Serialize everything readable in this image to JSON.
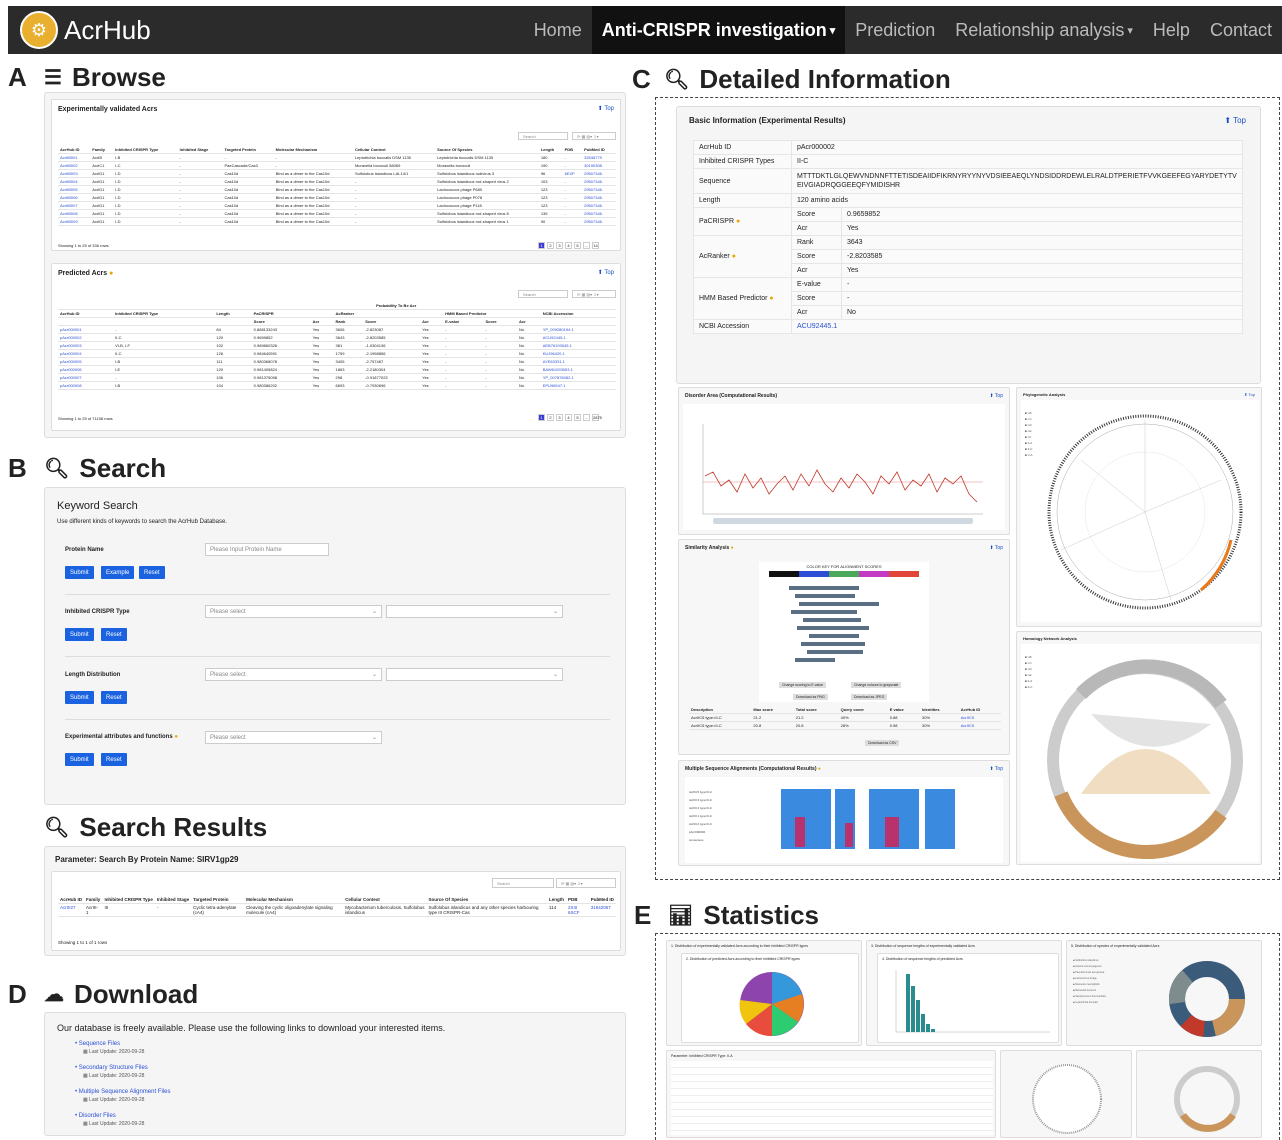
{
  "nav": {
    "brand": "AcrHub",
    "items": [
      "Home",
      "Anti-CRISPR investigation",
      "Prediction",
      "Relationship analysis",
      "Help",
      "Contact"
    ]
  },
  "sections": {
    "a_letter": "A",
    "a_title": "Browse",
    "b_letter": "B",
    "b_title": "Search",
    "sr_title": "Search Results",
    "c_letter": "C",
    "c_title": "Detailed Information",
    "d_letter": "D",
    "d_title": "Download",
    "e_letter": "E",
    "e_title": "Statistics"
  },
  "browse": {
    "top": "Top",
    "exp_title": "Experimentally validated Acrs",
    "exp_headers": [
      "AcrHub ID",
      "Family",
      "Inhibited CRISPR Type",
      "Inhibited Stage",
      "Targeted Protein",
      "Molecular Mechanism",
      "Cellular Context",
      "Source Of Species",
      "Length",
      "PDB",
      "PubMed ID"
    ],
    "exp_rows": [
      [
        "AcrIIB001",
        "AcrIB",
        "I-B",
        "-",
        "-",
        "-",
        "Leptotrichia buccalis DSM 1135",
        "Leptotrichia buccalis DSM 1135",
        "180",
        "-",
        "32548779"
      ],
      [
        "AcrIIB002",
        "AcrIC1",
        "I-C",
        "-",
        "PaeCascade/Cas3",
        "-",
        "Moraxella bovoculi 58069",
        "Moraxella bovoculi",
        "190",
        "-",
        "30190308"
      ],
      [
        "AcrIIB003",
        "AcrID1",
        "I-D",
        "-",
        "Cas10d",
        "Bind as a dimer to the Cas10d",
        "Sulfolobus islandicus LAL14/1",
        "Sulfolobus islandicus rudivirus 3",
        "96",
        "6EXP",
        "29507346"
      ],
      [
        "AcrIIB004",
        "AcrID1",
        "I-D",
        "-",
        "Cas10d",
        "Bind as a dimer to the Cas10d",
        "-",
        "Sulfolobus islandicus rod-shaped virus 2",
        "103",
        "-",
        "29507346"
      ],
      [
        "AcrIIB005",
        "AcrID1",
        "I-D",
        "-",
        "Cas10d",
        "Bind as a dimer to the Cas10d",
        "-",
        "Lactococcus phage P680",
        "123",
        "-",
        "29507346"
      ],
      [
        "AcrIIB006",
        "AcrID1",
        "I-D",
        "-",
        "Cas10d",
        "Bind as a dimer to the Cas10d",
        "-",
        "Lactococcus phage P078",
        "123",
        "-",
        "29507346"
      ],
      [
        "AcrIIB007",
        "AcrID1",
        "I-D",
        "-",
        "Cas10d",
        "Bind as a dimer to the Cas10d",
        "-",
        "Lactococcus phage P118",
        "123",
        "-",
        "29507346"
      ],
      [
        "AcrIIB008",
        "AcrID1",
        "I-D",
        "-",
        "Cas10d",
        "Bind as a dimer to the Cas10d",
        "-",
        "Sulfolobus islandicus rod-shaped virus 8",
        "139",
        "-",
        "29507346"
      ],
      [
        "AcrIIB009",
        "AcrID1",
        "I-D",
        "-",
        "Cas10d",
        "Bind as a dimer to the Cas10d",
        "-",
        "Sulfolobus islandicus rod-shaped virus 1",
        "90",
        "-",
        "29507346"
      ]
    ],
    "exp_footer": "Showing 1 to 25 of 336 rows",
    "pred_title": "Predicted Acrs",
    "pred_super": "Probability To Be Acr",
    "pred_headers": [
      "AcrHub ID",
      "Inhibited CRISPR Type",
      "Length",
      "PaCRISPR",
      "AcRanker",
      "HMM Based Predictor",
      "NCBI Accession"
    ],
    "pred_sub": [
      "Score",
      "Acr",
      "Rank",
      "Score",
      "Acr",
      "E-value",
      "Score",
      "Acr"
    ],
    "pred_rows": [
      [
        "pAcr000001",
        "-",
        "84",
        "0.888133243",
        "Yes",
        "3606",
        "-2.823087",
        "Yes",
        "-",
        "-",
        "No",
        "YP_009280194.1"
      ],
      [
        "pAcr000002",
        "II-C",
        "120",
        "0.9659852",
        "Yes",
        "3643",
        "-2.8203585",
        "Yes",
        "-",
        "-",
        "No",
        "ACU92445.1"
      ],
      [
        "pAcr000003",
        "VI-B, I-F",
        "102",
        "0.989860326",
        "Yes",
        "381",
        "-1.0304136",
        "Yes",
        "-",
        "-",
        "No",
        "AEB76193045.1"
      ],
      [
        "pAcr000004",
        "II-C",
        "126",
        "0.984640591",
        "Yes",
        "1759",
        "-2.1998856",
        "Yes",
        "-",
        "-",
        "No",
        "KUJ96420.1"
      ],
      [
        "pAcr000005",
        "I-B",
        "111",
        "0.980368078",
        "Yes",
        "3405",
        "-2.757487",
        "Yes",
        "-",
        "-",
        "No",
        "AYE63331.1"
      ],
      [
        "pAcr000006",
        "I-E",
        "120",
        "0.981405824",
        "Yes",
        "1863",
        "-2.2180304",
        "Yes",
        "-",
        "-",
        "No",
        "BAW61093053.1"
      ],
      [
        "pAcr000007",
        "-",
        "106",
        "0.981375098",
        "Yes",
        "298",
        "-0.91877023",
        "Yes",
        "-",
        "-",
        "No",
        "YP_007878082.1"
      ],
      [
        "pAcr000008",
        "I-B",
        "104",
        "0.980386202",
        "Yes",
        "6693",
        "-0.7930696",
        "Yes",
        "-",
        "-",
        "No",
        "EPU96547.1"
      ]
    ],
    "pred_footer": "Showing 1 to 25 of 71158 rows",
    "search_ph": "Search"
  },
  "search": {
    "title": "Keyword Search",
    "subtitle": "Use different kinds of keywords to search the AcrHub Database.",
    "protein_label": "Protein Name",
    "protein_ph": "Please Input Protein Name",
    "type_label": "Inhibited CRISPR Type",
    "length_label": "Length Distribution",
    "attr_label": "Experimental attributes and functions",
    "select_ph": "Please select",
    "submit": "Submit",
    "example": "Example",
    "reset": "Reset"
  },
  "results": {
    "param": "Parameter: Search By Protein Name: SIRV1gp29",
    "headers": [
      "AcrHub ID",
      "Family",
      "Inhibited CRISPR Type",
      "Inhibited Stage",
      "Targeted Protein",
      "Molecular Mechanism",
      "Cellular Context",
      "Source Of Species",
      "Length",
      "PDB",
      "PubMed ID"
    ],
    "row": [
      "AcrIII27",
      "AcrIII-1",
      "III",
      "-",
      "Cyclic tetra-adenylate (cA4)",
      "Cleaving the cyclic oligoadenylate signaling molecule (cA4)",
      "Mycobacterium tuberculosis, Sulfolobus islandicus",
      "Sulfolobus islandicus and any other species harbouring type III CRISPR-Cas",
      "114",
      "2X4I 6SCF",
      "31942067"
    ],
    "footer": "Showing 1 to 1 of 1 rows"
  },
  "download": {
    "intro": "Our database is freely available. Please use the following links to download your interested items.",
    "files": [
      {
        "name": "Sequence Files",
        "date": "Last Update: 2020-09-28"
      },
      {
        "name": "Secondary Structure Files",
        "date": "Last Update: 2020-09-28"
      },
      {
        "name": "Multiple Sequence Alignment Files",
        "date": "Last Update: 2020-09-28"
      },
      {
        "name": "Disorder Files",
        "date": "Last Update: 2020-09-28"
      }
    ]
  },
  "detail": {
    "title": "Basic Information (Experimental Results)",
    "top": "Top",
    "acrhub_id_label": "AcrHub ID",
    "acrhub_id": "pAcr000002",
    "type_label": "Inhibited CRISPR Types",
    "type": "II-C",
    "seq_label": "Sequence",
    "seq": "MTTTDKTLGLQEWVNDNNFTTETISDEAIIDFIKRNYRYYNYVDSIEEAEQLYNDSIDDRDEWLELRALDTPERIETFVVKGEEFEGYARYDETYTVEIVGIADRQGGEEQFYMIDISHR",
    "length_label": "Length",
    "length": "120 amino acids",
    "pacrispr_label": "PaCRISPR",
    "acranker_label": "AcRanker",
    "hmm_label": "HMM Based Predictor",
    "score_label": "Score",
    "acr_label": "Acr",
    "rank_label": "Rank",
    "evalue_label": "E-value",
    "pacrispr_score": "0.9659852",
    "pacrispr_acr": "Yes",
    "acranker_rank": "3643",
    "acranker_score": "-2.8203585",
    "acranker_acr": "Yes",
    "hmm_evalue": "-",
    "hmm_score": "-",
    "hmm_acr": "No",
    "ncbi_label": "NCBI Accession",
    "ncbi": "ACU92445.1",
    "disorder_title": "Disorder Area (Computational Results)",
    "phylo_title": "Phylogenetic Analysis",
    "similarity_title": "Similarity Analysis",
    "color_key": "COLOR KEY FOR ALIGNMENT SCORES",
    "homology_title": "Homology Network Analysis",
    "msa_title": "Multiple Sequence Alignments (Computational Results)",
    "sim_headers": [
      "Description",
      "Max score",
      "Total score",
      "Query cover",
      "E value",
      "Identities",
      "AcrHub ID"
    ],
    "sim_rows": [
      [
        "AcrIIC5 type=II-C",
        "21.2",
        "21.2",
        "40%",
        "0.88",
        "30%",
        "AcrIIC5"
      ],
      [
        "AcrIIC5 type=II-C",
        "20.8",
        "20.8",
        "28%",
        "0.98",
        "30%",
        "AcrIIC5"
      ]
    ],
    "btns": [
      "Change scoring to E value",
      "Change colours to grayscale",
      "Download as PNG",
      "Download as JPEG",
      "Download as CSV"
    ]
  },
  "stats": {
    "c1": "1. Distribution of experimentally validated Acrs according to their inhibited CRISPR types",
    "c2": "2. Distribution of predicted Acrs according to their inhibited CRISPR types",
    "c3": "3. Distribution of sequence lengths of experimentally validated Acrs",
    "c4": "4. Distribution of sequence lengths of predicted Acrs",
    "c5": "5. Distribution of species of experimentally validated Acrs",
    "c6": "Parameter: Inhibited CRISPR Type: II-A"
  },
  "colors": {
    "nav": "#2b2b2b",
    "accent": "#1a62e0",
    "link": "#2a4fd6"
  }
}
